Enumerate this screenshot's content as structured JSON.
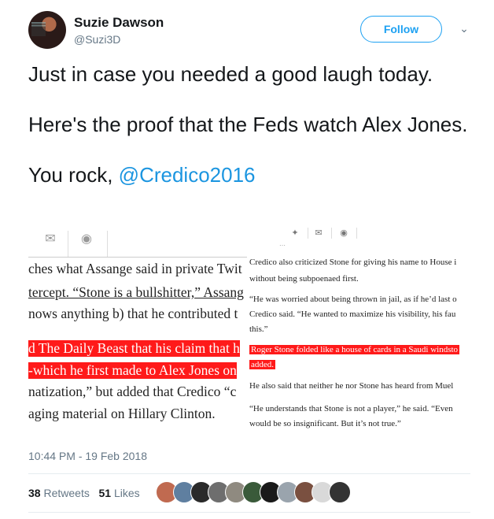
{
  "user": {
    "name": "Suzie Dawson",
    "handle": "@Suzi3D"
  },
  "follow_label": "Follow",
  "tweet": {
    "line1": "Just in case you needed a good laugh today.",
    "line2": "Here's the proof that the Feds watch Alex Jones.",
    "line3_prefix": "You rock, ",
    "mention": "@Credico2016"
  },
  "media": {
    "left_lines": [
      "ches what Assange said in private Twit",
      "tercept. “Stone is a bullshitter,” Assang",
      "nows anything b) that he contributed t",
      "d The Daily Beast that his claim that h",
      "-which he first made to Alex Jones on",
      "natization,” but added that Credico “c",
      "aging material on Hillary Clinton."
    ],
    "right_lines": [
      "Credico also criticized Stone for giving his name to House i",
      "without being subpoenaed first.",
      "“He was worried about being thrown in jail, as if he’d last o",
      "Credico said. “He wanted to maximize his visibility, his fau",
      "this.”",
      "Roger Stone folded like a house of cards in a Saudi windsto",
      "added.",
      "He also said that neither he nor Stone has heard from Muel",
      "“He understands that Stone is not a player,” he said. “Even",
      "would be so insignificant. But it’s not true.”"
    ],
    "right_cut_text": "…"
  },
  "timestamp": "10:44 PM - 19 Feb 2018",
  "stats": {
    "retweets_count": "38",
    "retweets_label": "Retweets",
    "likes_count": "51",
    "likes_label": "Likes"
  },
  "likers_colors": [
    "#c06a50",
    "#5f7fa0",
    "#2a2a2a",
    "#6e6e6e",
    "#8f8a80",
    "#3a5a3a",
    "#1a1a1a",
    "#9aa4ad",
    "#7a5040",
    "#d9d9d9",
    "#333333"
  ],
  "colors": {
    "accent": "#1da1f2",
    "highlight": "#ff1a1a"
  }
}
